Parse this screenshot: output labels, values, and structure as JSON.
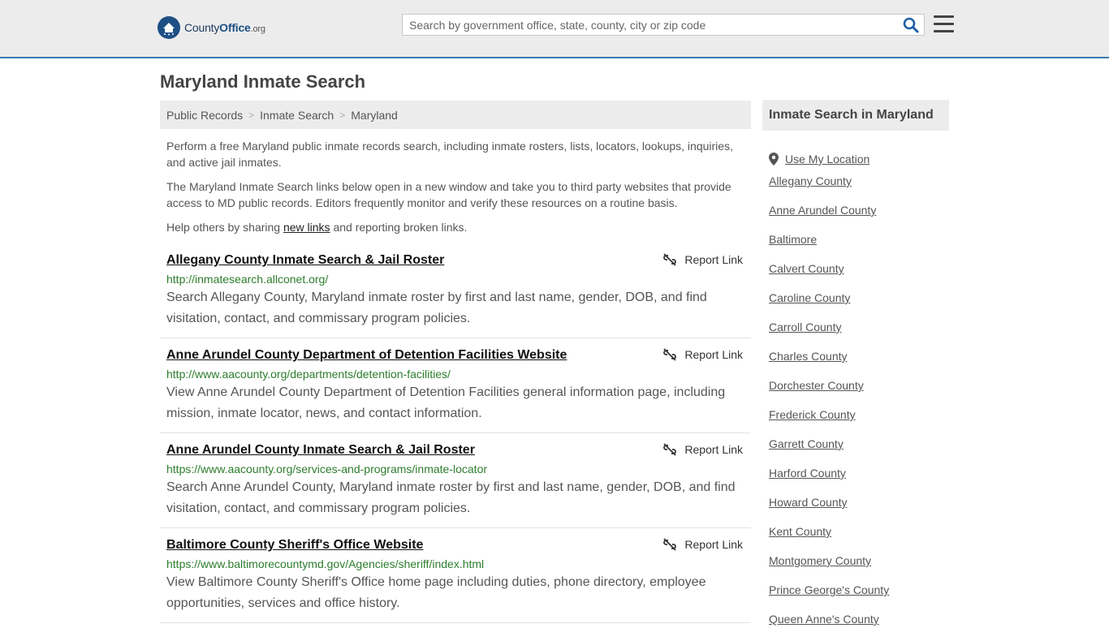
{
  "header": {
    "logo_word1": "County",
    "logo_word2": "Office",
    "logo_tld": ".org",
    "search_placeholder": "Search by government office, state, county, city or zip code",
    "icons": {
      "search": "search-icon",
      "menu": "hamburger-menu-icon",
      "logo": "capitol-seal-icon"
    }
  },
  "page_title": "Maryland Inmate Search",
  "breadcrumb": [
    "Public Records",
    "Inmate Search",
    "Maryland"
  ],
  "intro": {
    "p1": "Perform a free Maryland public inmate records search, including inmate rosters, lists, locators, lookups, inquiries, and active jail inmates.",
    "p2": "The Maryland Inmate Search links below open in a new window and take you to third party websites that provide access to MD public records. Editors frequently monitor and verify these resources on a routine basis.",
    "p3_before": "Help others by sharing ",
    "p3_link": "new links",
    "p3_after": " and reporting broken links."
  },
  "report_label": "Report Link",
  "results": [
    {
      "title": "Allegany County Inmate Search & Jail Roster",
      "url": "http://inmatesearch.allconet.org/",
      "desc": "Search Allegany County, Maryland inmate roster by first and last name, gender, DOB, and find visitation, contact, and commissary program policies."
    },
    {
      "title": "Anne Arundel County Department of Detention Facilities Website",
      "url": "http://www.aacounty.org/departments/detention-facilities/",
      "desc": "View Anne Arundel County Department of Detention Facilities general information page, including mission, inmate locator, news, and contact information."
    },
    {
      "title": "Anne Arundel County Inmate Search & Jail Roster",
      "url": "https://www.aacounty.org/services-and-programs/inmate-locator",
      "desc": "Search Anne Arundel County, Maryland inmate roster by first and last name, gender, DOB, and find visitation, contact, and commissary program policies."
    },
    {
      "title": "Baltimore County Sheriff's Office Website",
      "url": "https://www.baltimorecountymd.gov/Agencies/sheriff/index.html",
      "desc": "View Baltimore County Sheriff's Office home page including duties, phone directory, employee opportunities, services and office history."
    }
  ],
  "sidebar": {
    "title": "Inmate Search in Maryland",
    "use_location": "Use My Location",
    "counties": [
      "Allegany County",
      "Anne Arundel County",
      "Baltimore",
      "Calvert County",
      "Caroline County",
      "Carroll County",
      "Charles County",
      "Dorchester County",
      "Frederick County",
      "Garrett County",
      "Harford County",
      "Howard County",
      "Kent County",
      "Montgomery County",
      "Prince George's County",
      "Queen Anne's County"
    ]
  },
  "colors": {
    "accent": "#3f78b4",
    "logo_blue": "#1e4f85",
    "url_green": "#2d7d2d",
    "panel_gray": "#ececec"
  }
}
